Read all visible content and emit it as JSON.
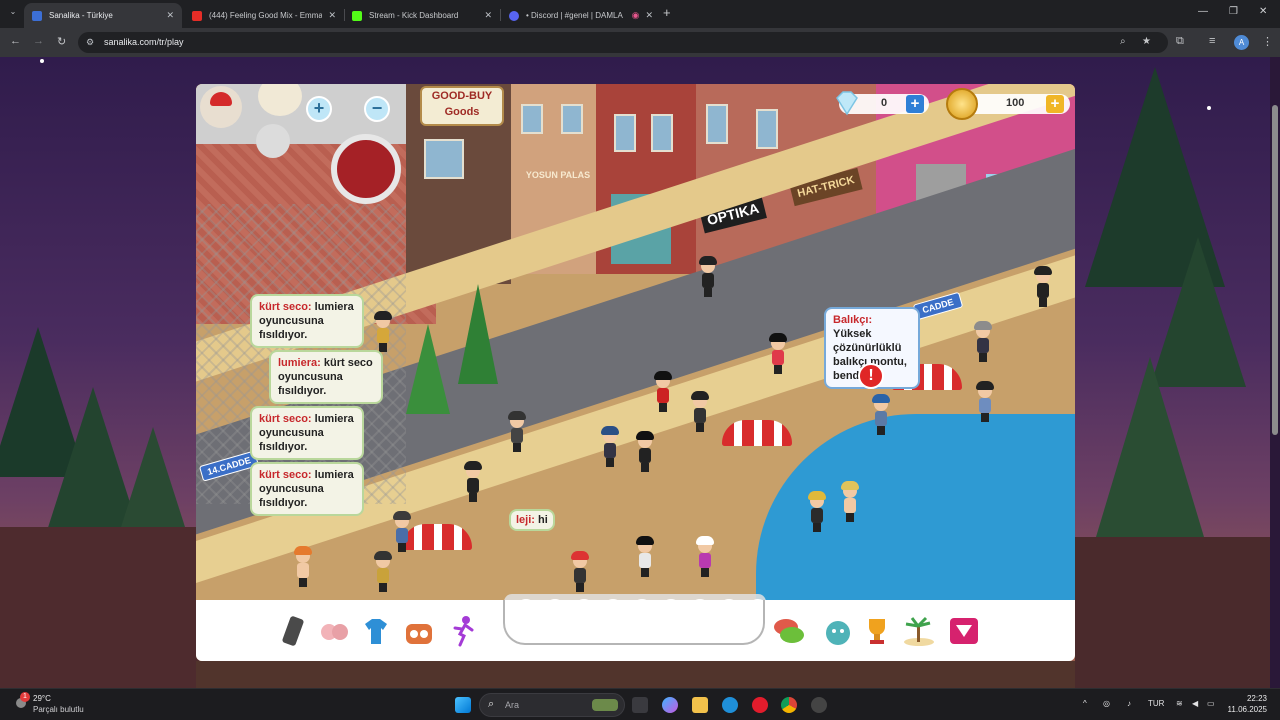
{
  "browser": {
    "tabs": [
      {
        "title": "Sanalika - Türkiye",
        "active": true
      },
      {
        "title": "(444) Feeling Good Mix - Emma",
        "active": false
      },
      {
        "title": "Stream - Kick Dashboard",
        "active": false
      },
      {
        "title": "• Discord | #genel | DAMLA",
        "active": false
      }
    ],
    "url": "sanalika.com/tr/play",
    "profile_initial": "A"
  },
  "game": {
    "diamonds": "0",
    "coins": "100",
    "signs": {
      "goodbuy": "GOOD-BUY Goods",
      "yosun": "YOSUN PALAS",
      "optika": "OPTIKA",
      "hattrick": "HAT-TRICK",
      "cadde1": "CADDE",
      "cadde14": "14.CADDE"
    },
    "chat": [
      {
        "who": "kürt seco:",
        "text": "lumiera oyuncusuna fısıldıyor."
      },
      {
        "who": "lumiera:",
        "text": "kürt seco oyuncusuna fısıldıyor."
      },
      {
        "who": "kürt seco:",
        "text": "lumiera oyuncusuna fısıldıyor."
      },
      {
        "who": "kürt seco:",
        "text": "lumiera oyuncusuna fısıldıyor."
      }
    ],
    "balikci": {
      "who": "Balıkçı:",
      "text": "Yüksek çözünürlüklü balıkçı montu, bende!"
    },
    "leji": {
      "who": "leji:",
      "text": "hi"
    },
    "palette": [
      "#f4f4f4",
      "#3ec47e",
      "#f0b230",
      "#8a8a8a",
      "#1a1a1a",
      "#d95f5f",
      "#e79be4",
      "#3b3b3b",
      "#f09a1e"
    ],
    "accent": {
      "diamond_plus": "#2f7fd6",
      "coin_plus": "#f0b626"
    }
  },
  "taskbar": {
    "weather_temp": "29°C",
    "weather_desc": "Parçalı bulutlu",
    "weather_badge": "1",
    "search_placeholder": "Ara",
    "lang": "TUR",
    "time": "22:23",
    "date": "11.06.2025"
  }
}
